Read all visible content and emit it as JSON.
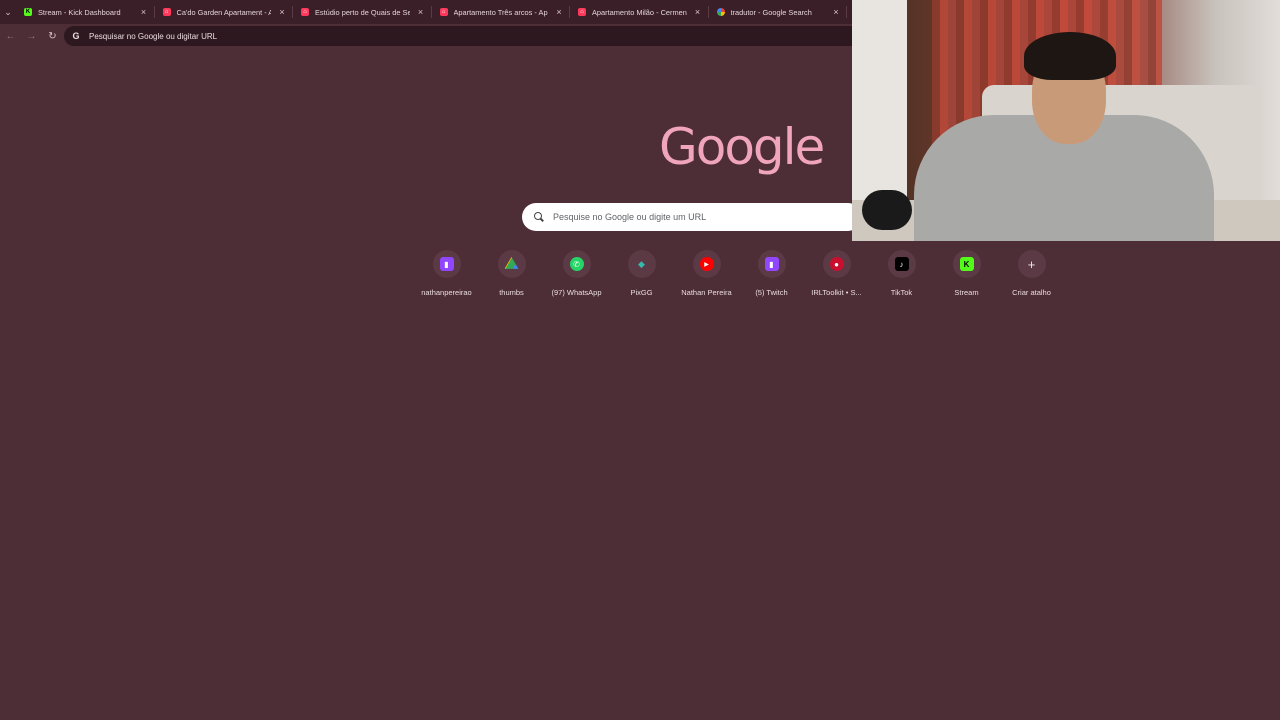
{
  "tabs": [
    {
      "title": "Stream - Kick Dashboard",
      "favicon": "kick"
    },
    {
      "title": "Ca'do Garden Apartament - Ap",
      "favicon": "airbnb"
    },
    {
      "title": "Estúdio perto de Quais de Sein",
      "favicon": "airbnb"
    },
    {
      "title": "Apartamento Três arcos - Apar",
      "favicon": "airbnb"
    },
    {
      "title": "Apartamento Milão - Cermenat",
      "favicon": "airbnb"
    },
    {
      "title": "tradutor - Google Search",
      "favicon": "google"
    }
  ],
  "tab_close_glyph": "×",
  "omnibox": {
    "text": "Pesquisar no Google ou digitar URL",
    "icon": "google-g-icon"
  },
  "logo": "Google",
  "search": {
    "placeholder": "Pesquise no Google ou digite um URL"
  },
  "shortcuts": [
    {
      "label": "nathanpereirao",
      "icon": "twitch-icon"
    },
    {
      "label": "thumbs",
      "icon": "google-drive-icon"
    },
    {
      "label": "(97) WhatsApp",
      "icon": "whatsapp-icon"
    },
    {
      "label": "PixGG",
      "icon": "pixgg-icon"
    },
    {
      "label": "Nathan Pereira",
      "icon": "youtube-icon"
    },
    {
      "label": "(5) Twitch",
      "icon": "twitch-icon"
    },
    {
      "label": "IRLToolkit • S...",
      "icon": "irltoolkit-icon"
    },
    {
      "label": "TikTok",
      "icon": "tiktok-icon"
    },
    {
      "label": "Stream",
      "icon": "kick-icon"
    },
    {
      "label": "Criar atalho",
      "icon": "plus-icon"
    }
  ],
  "colors": {
    "background": "#4d2d36",
    "tabstrip": "#3a1f28",
    "logo": "#f0a5bd",
    "kick": "#53fc18",
    "airbnb": "#ff385c",
    "twitch": "#9146ff"
  }
}
